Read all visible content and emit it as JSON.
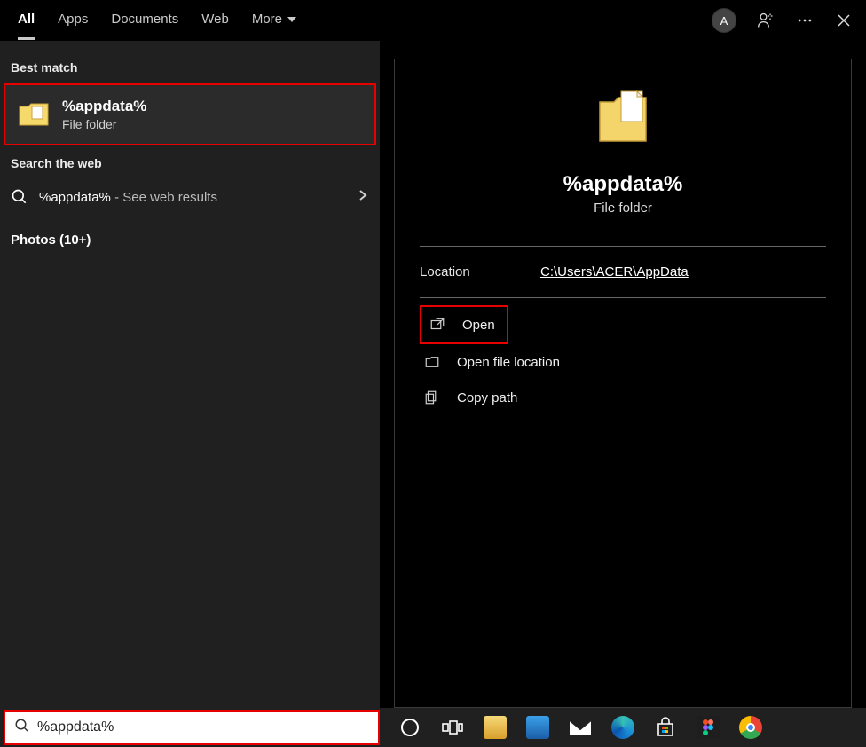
{
  "header": {
    "tabs": [
      "All",
      "Apps",
      "Documents",
      "Web",
      "More"
    ],
    "active_tab": 0,
    "avatar_letter": "A"
  },
  "left": {
    "best_match_label": "Best match",
    "result": {
      "title": "%appdata%",
      "subtitle": "File folder"
    },
    "search_web_label": "Search the web",
    "web_result": {
      "term": "%appdata%",
      "suffix": " - See web results"
    },
    "photos_label": "Photos (10+)"
  },
  "detail": {
    "title": "%appdata%",
    "subtitle": "File folder",
    "location_label": "Location",
    "location_value": "C:\\Users\\ACER\\AppData",
    "actions": [
      "Open",
      "Open file location",
      "Copy path"
    ]
  },
  "taskbar": {
    "search_value": "%appdata%",
    "pins": [
      "cortana",
      "task-view",
      "file-explorer",
      "computer",
      "mail",
      "edge",
      "store",
      "figma",
      "chrome"
    ]
  }
}
